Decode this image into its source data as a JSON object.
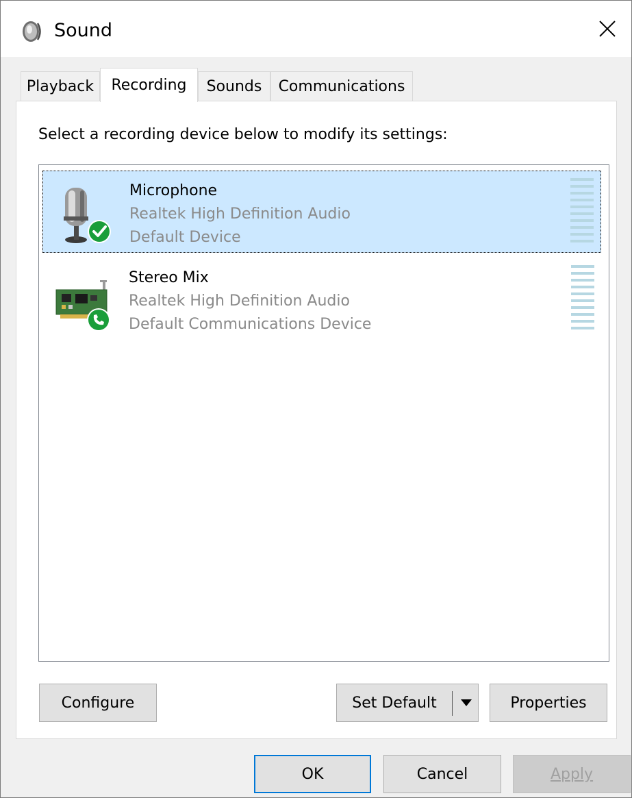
{
  "window": {
    "title": "Sound",
    "close_icon": "close-icon",
    "title_icon": "speaker-icon"
  },
  "tabs": [
    {
      "label": "Playback",
      "active": false
    },
    {
      "label": "Recording",
      "active": true
    },
    {
      "label": "Sounds",
      "active": false
    },
    {
      "label": "Communications",
      "active": false
    }
  ],
  "panel": {
    "instructions": "Select a recording device below to modify its settings:"
  },
  "devices": [
    {
      "name": "Microphone",
      "driver": "Realtek High Definition Audio",
      "status": "Default Device",
      "icon": "microphone-icon",
      "badge_icon": "default-check-badge-icon",
      "selected": true,
      "level": 0
    },
    {
      "name": "Stereo Mix",
      "driver": "Realtek High Definition Audio",
      "status": "Default Communications Device",
      "icon": "sound-card-icon",
      "badge_icon": "phone-badge-icon",
      "selected": false,
      "level": 0
    }
  ],
  "panel_buttons": {
    "configure": "Configure",
    "set_default": "Set Default",
    "properties": "Properties"
  },
  "dialog_buttons": {
    "ok": "OK",
    "cancel": "Cancel",
    "apply": "Apply"
  },
  "colors": {
    "selection": "#cce8ff",
    "accent": "#0078d7",
    "badge_green": "#1a9e3a",
    "meter_bar": "#b6d7e2"
  }
}
